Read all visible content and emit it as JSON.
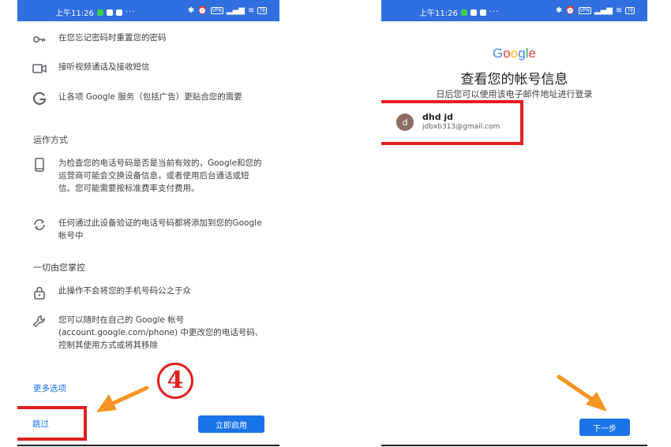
{
  "statusbar": {
    "time": "上午11:26",
    "vpn": "VPN",
    "battery": "78"
  },
  "left": {
    "rows_top": [
      {
        "icon": "key-icon",
        "text": "在您忘记密码时重置您的密码"
      },
      {
        "icon": "video-icon",
        "text": "接听视频通话及接收短信"
      },
      {
        "icon": "google-g-icon",
        "text": "让各项 Google 服务（包括广告）更贴合您的需要"
      }
    ],
    "section_how": "运作方式",
    "rows_how": [
      {
        "icon": "phone-icon",
        "text": "为检查您的电话号码是否是当前有效的，Google和您的运营商可能会交换设备信息，或者使用后台通话或短信。您可能需要按标准费率支付费用。"
      },
      {
        "icon": "sync-icon",
        "text": "任何通过此设备验证的电话号码都将添加到您的Google 帐号中"
      }
    ],
    "section_control": "一切由您掌控",
    "rows_control": [
      {
        "icon": "lock-icon",
        "text": "此操作不会将您的手机号码公之于众"
      },
      {
        "icon": "wrench-icon",
        "text": "您可以随时在自己的 Google 帐号(account.google.com/phone) 中更改您的电话号码、控制其使用方式或将其移除"
      }
    ],
    "more_options": "更多选项",
    "skip": "跳过",
    "enable_now": "立即启用",
    "step_number": "4"
  },
  "right": {
    "logo": [
      "G",
      "o",
      "o",
      "g",
      "l",
      "e"
    ],
    "logo_colors": [
      "#4285F4",
      "#EA4335",
      "#FBBC05",
      "#4285F4",
      "#34A853",
      "#EA4335"
    ],
    "title": "查看您的帐号信息",
    "subtitle": "日后您可以使用该电子邮件地址进行登录",
    "account": {
      "initial": "d",
      "name": "dhd jd",
      "email": "jdbxb313@gmail.com"
    },
    "next": "下一步"
  },
  "colors": {
    "accent": "#1a73e8",
    "annotation_red": "#e2201e",
    "arrow_orange": "#f5941e",
    "statusbar": "#2f6fe0"
  }
}
